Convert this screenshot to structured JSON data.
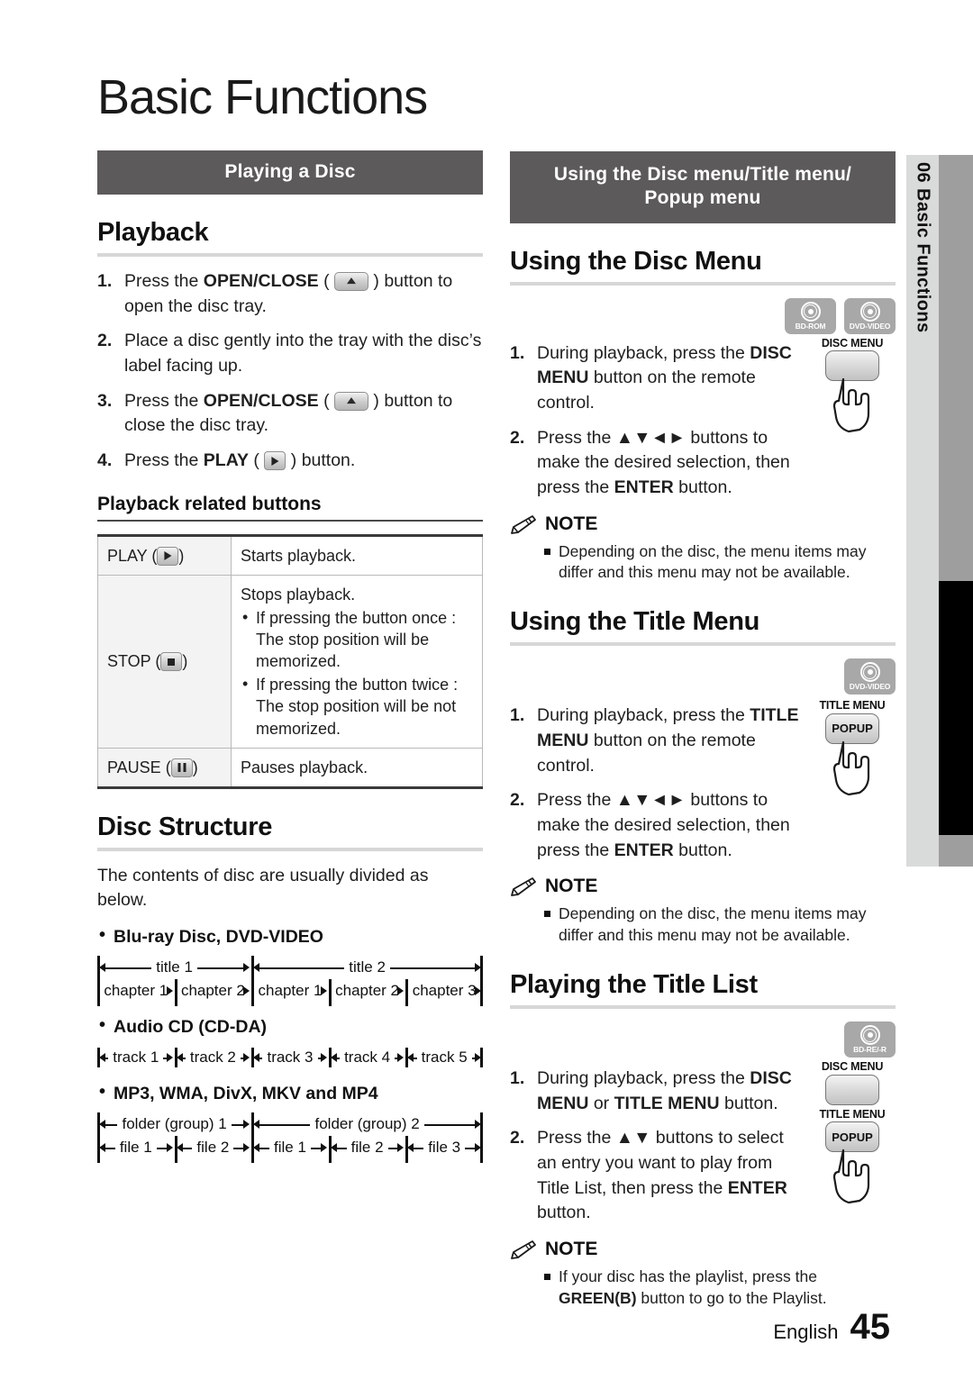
{
  "chapter": {
    "title": "Basic Functions",
    "number": "06",
    "side_tab": "06   Basic Functions"
  },
  "footer": {
    "language": "English",
    "page": "45"
  },
  "left": {
    "banner": "Playing a Disc",
    "playback": {
      "heading": "Playback",
      "steps": [
        {
          "num": "1.",
          "pre": "Press the ",
          "bold": "OPEN/CLOSE",
          "icon": "eject-button-icon",
          "post": " ) button to open the disc tray."
        },
        {
          "num": "2.",
          "pre": "Place a disc gently into the tray with the disc’s label facing up.",
          "bold": "",
          "icon": "",
          "post": ""
        },
        {
          "num": "3.",
          "pre": "Press the ",
          "bold": "OPEN/CLOSE",
          "icon": "eject-button-icon",
          "post": " ) button to close the disc tray."
        },
        {
          "num": "4.",
          "pre": "Press the ",
          "bold": "PLAY",
          "icon": "play-button-icon",
          "post": " ) button."
        }
      ],
      "sub_heading": "Playback related buttons",
      "table": {
        "rows": [
          {
            "key": "PLAY",
            "icon": "play-button-icon",
            "desc": "Starts playback.",
            "bullets": []
          },
          {
            "key": "STOP",
            "icon": "stop-button-icon",
            "desc": "Stops playback.",
            "bullets": [
              "If pressing the button once : The stop position will be memorized.",
              "If pressing the button twice : The stop position will be not memorized."
            ]
          },
          {
            "key": "PAUSE",
            "icon": "pause-button-icon",
            "desc": "Pauses playback.",
            "bullets": []
          }
        ]
      }
    },
    "disc_structure": {
      "heading": "Disc Structure",
      "intro": "The contents of disc are usually divided as below.",
      "groups": [
        {
          "label": "Blu-ray Disc, DVD-VIDEO",
          "top_row": [
            "title 1",
            "title 2"
          ],
          "top_weights": [
            2,
            3
          ],
          "bottom_row": [
            "chapter 1",
            "chapter 2",
            "chapter 1",
            "chapter 2",
            "chapter 3"
          ]
        },
        {
          "label": "Audio CD (CD-DA)",
          "top_row": [],
          "top_weights": [],
          "bottom_row": [
            "track 1",
            "track 2",
            "track 3",
            "track 4",
            "track 5"
          ]
        },
        {
          "label": "MP3, WMA, DivX, MKV and MP4",
          "top_row": [
            "folder (group) 1",
            "folder (group) 2"
          ],
          "top_weights": [
            2,
            3
          ],
          "bottom_row": [
            "file 1",
            "file 2",
            "file 1",
            "file 2",
            "file 3"
          ]
        }
      ]
    }
  },
  "right": {
    "banner_line1": "Using the Disc menu/Title menu/",
    "banner_line2": "Popup menu",
    "sections": [
      {
        "heading": "Using the Disc Menu",
        "badges": [
          {
            "label": "BD-ROM",
            "name": "bd-rom-badge"
          },
          {
            "label": "DVD-VIDEO",
            "name": "dvd-video-badge"
          }
        ],
        "keys": [
          {
            "label": "DISC MENU",
            "cap": "",
            "hand": true
          }
        ],
        "steps": [
          {
            "num": "1.",
            "segments": [
              {
                "t": "During playback, press the ",
                "b": false
              },
              {
                "t": "DISC MENU",
                "b": true
              },
              {
                "t": " button on the remote control.",
                "b": false
              }
            ]
          },
          {
            "num": "2.",
            "segments": [
              {
                "t": "Press the ",
                "b": false
              },
              {
                "t": "▲▼◄►",
                "b": false
              },
              {
                "t": " buttons to make the desired selection, then press the ",
                "b": false
              },
              {
                "t": "ENTER",
                "b": true
              },
              {
                "t": " button.",
                "b": false
              }
            ]
          }
        ],
        "note_title": "NOTE",
        "notes": [
          "Depending on the disc, the menu items may differ and this menu may not be available."
        ]
      },
      {
        "heading": "Using the Title Menu",
        "badges": [
          {
            "label": "DVD-VIDEO",
            "name": "dvd-video-badge"
          }
        ],
        "keys": [
          {
            "label": "TITLE MENU",
            "cap": "POPUP",
            "hand": true
          }
        ],
        "steps": [
          {
            "num": "1.",
            "segments": [
              {
                "t": "During playback, press the ",
                "b": false
              },
              {
                "t": "TITLE MENU",
                "b": true
              },
              {
                "t": " button on the remote control.",
                "b": false
              }
            ]
          },
          {
            "num": "2.",
            "segments": [
              {
                "t": "Press the ",
                "b": false
              },
              {
                "t": "▲▼◄►",
                "b": false
              },
              {
                "t": " buttons to make the desired selection, then press the ",
                "b": false
              },
              {
                "t": "ENTER",
                "b": true
              },
              {
                "t": " button.",
                "b": false
              }
            ]
          }
        ],
        "note_title": "NOTE",
        "notes": [
          "Depending on the disc, the menu items may differ and this menu may not be available."
        ]
      },
      {
        "heading": "Playing the Title List",
        "badges": [
          {
            "label": "BD-RE/-R",
            "name": "bd-re-r-badge"
          }
        ],
        "keys": [
          {
            "label": "DISC MENU",
            "cap": "",
            "hand": false
          },
          {
            "label": "TITLE MENU",
            "cap": "POPUP",
            "hand": true
          }
        ],
        "steps": [
          {
            "num": "1.",
            "segments": [
              {
                "t": "During playback, press the ",
                "b": false
              },
              {
                "t": "DISC MENU",
                "b": true
              },
              {
                "t": " or ",
                "b": false
              },
              {
                "t": "TITLE MENU",
                "b": true
              },
              {
                "t": " button.",
                "b": false
              }
            ]
          },
          {
            "num": "2.",
            "segments": [
              {
                "t": "Press the ",
                "b": false
              },
              {
                "t": "▲▼",
                "b": false
              },
              {
                "t": " buttons to select an entry you want to play from Title List, then press the ",
                "b": false
              },
              {
                "t": "ENTER",
                "b": true
              },
              {
                "t": " button.",
                "b": false
              }
            ]
          }
        ],
        "note_title": "NOTE",
        "notes": [
          "If your disc has the playlist, press the GREEN(B) button to go to the Playlist."
        ]
      }
    ]
  },
  "colors": {
    "banner_bg": "#5c5a5b",
    "rule": "#d7d7d7",
    "tab_bg": "#d9dbda",
    "tab_bar": "#9e9e9e",
    "badge_bg": "#a8a8a8"
  }
}
